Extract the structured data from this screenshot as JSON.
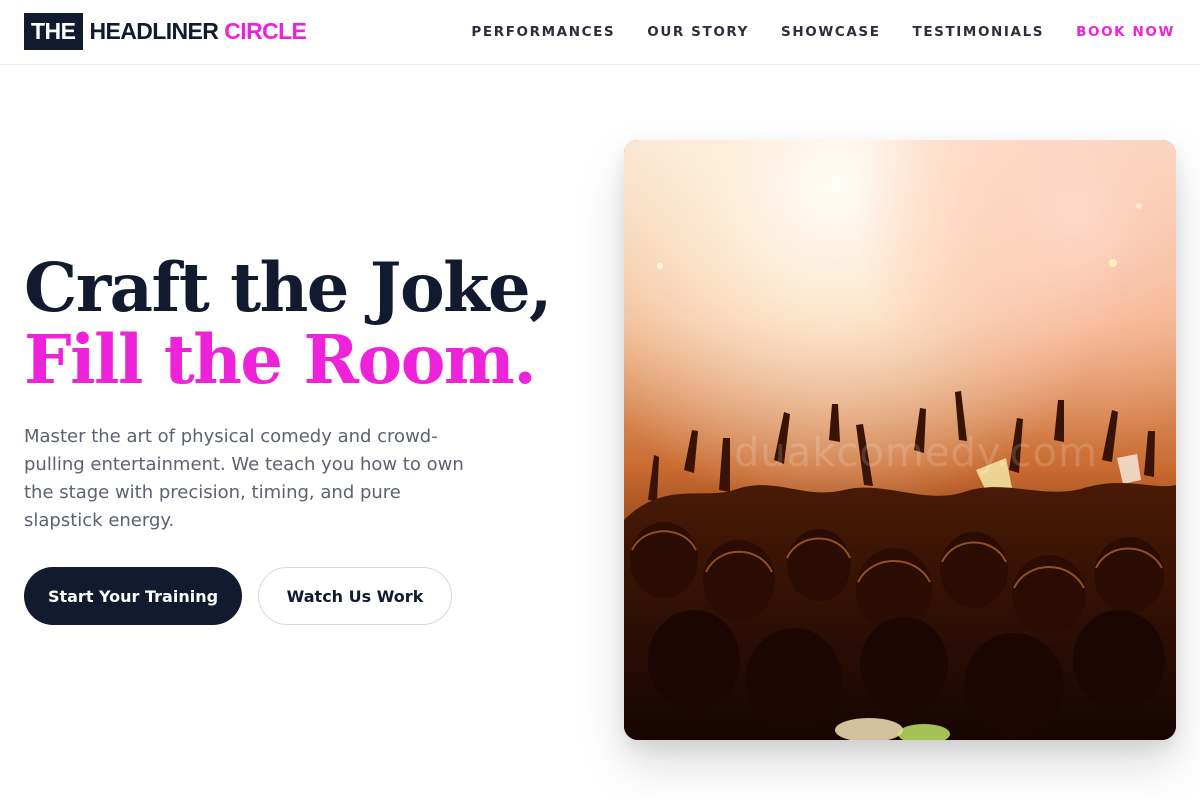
{
  "brand": {
    "box": "THE",
    "word": "HEADLINER",
    "accent": "CIRCLE"
  },
  "nav": {
    "items": [
      "PERFORMANCES",
      "OUR STORY",
      "SHOWCASE",
      "TESTIMONIALS"
    ],
    "cta": "BOOK NOW"
  },
  "hero": {
    "headline_line1": "Craft the Joke,",
    "headline_line2": "Fill the Room.",
    "lead": "Master the art of physical comedy and crowd-pulling entertainment. We teach you how to own the stage with precision, timing, and pure slapstick energy.",
    "primary_button": "Start Your Training",
    "secondary_button": "Watch Us Work",
    "image_alt": "Concert crowd with raised hands under stage lights",
    "image_watermark": "duakcomedy.com"
  },
  "colors": {
    "navy": "#111a2e",
    "accent": "#ee22d8",
    "body_text": "#5b6270"
  }
}
